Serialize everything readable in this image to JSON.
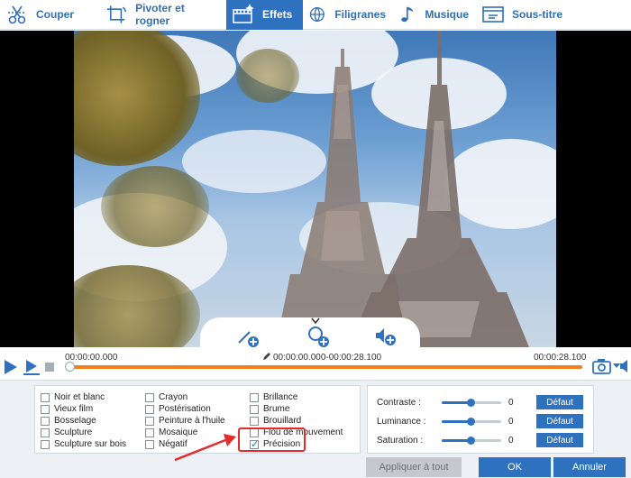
{
  "toolbar": {
    "tabs": [
      {
        "label": "Couper",
        "icon": "cut-icon",
        "active": false
      },
      {
        "label": "Pivoter et rogner",
        "icon": "rotate-crop-icon",
        "active": false
      },
      {
        "label": "Effets",
        "icon": "effects-icon",
        "active": true
      },
      {
        "label": "Filigranes",
        "icon": "watermark-icon",
        "active": false
      },
      {
        "label": "Musique",
        "icon": "music-icon",
        "active": false
      },
      {
        "label": "Sous-titre",
        "icon": "subtitle-icon",
        "active": false
      }
    ]
  },
  "preview": {
    "overlay_icons": [
      "magic-wand-add-icon",
      "zoom-add-icon",
      "audio-add-icon"
    ]
  },
  "timeline": {
    "start_time": "00:00:00.000",
    "range": "00:00:00.000-00:00:28.100",
    "end_time": "00:00:28.100",
    "position": 0
  },
  "effects": {
    "col1": [
      {
        "label": "Noir et blanc",
        "checked": false
      },
      {
        "label": "Vieux film",
        "checked": false
      },
      {
        "label": "Bosselage",
        "checked": false
      },
      {
        "label": "Sculpture",
        "checked": false
      },
      {
        "label": "Sculpture sur bois",
        "checked": false
      }
    ],
    "col2": [
      {
        "label": "Crayon",
        "checked": false
      },
      {
        "label": "Postérisation",
        "checked": false
      },
      {
        "label": "Peinture à l'huile",
        "checked": false
      },
      {
        "label": "Mosaique",
        "checked": false
      },
      {
        "label": "Négatif",
        "checked": false
      }
    ],
    "col3": [
      {
        "label": "Brillance",
        "checked": false
      },
      {
        "label": "Brume",
        "checked": false
      },
      {
        "label": "Brouillard",
        "checked": false
      },
      {
        "label": "Flou de mouvement",
        "checked": false
      },
      {
        "label": "Précision",
        "checked": true
      }
    ]
  },
  "adjust": {
    "rows": [
      {
        "label": "Contraste :",
        "value": "0",
        "level": 0.5,
        "button": "Défaut"
      },
      {
        "label": "Luminance :",
        "value": "0",
        "level": 0.5,
        "button": "Défaut"
      },
      {
        "label": "Saturation :",
        "value": "0",
        "level": 0.5,
        "button": "Défaut"
      }
    ]
  },
  "footer": {
    "apply_all": "Appliquer à tout",
    "ok": "OK",
    "cancel": "Annuler"
  },
  "colors": {
    "accent": "#2e72bf",
    "progress": "#f07f1e",
    "highlight": "#e52a2a"
  }
}
